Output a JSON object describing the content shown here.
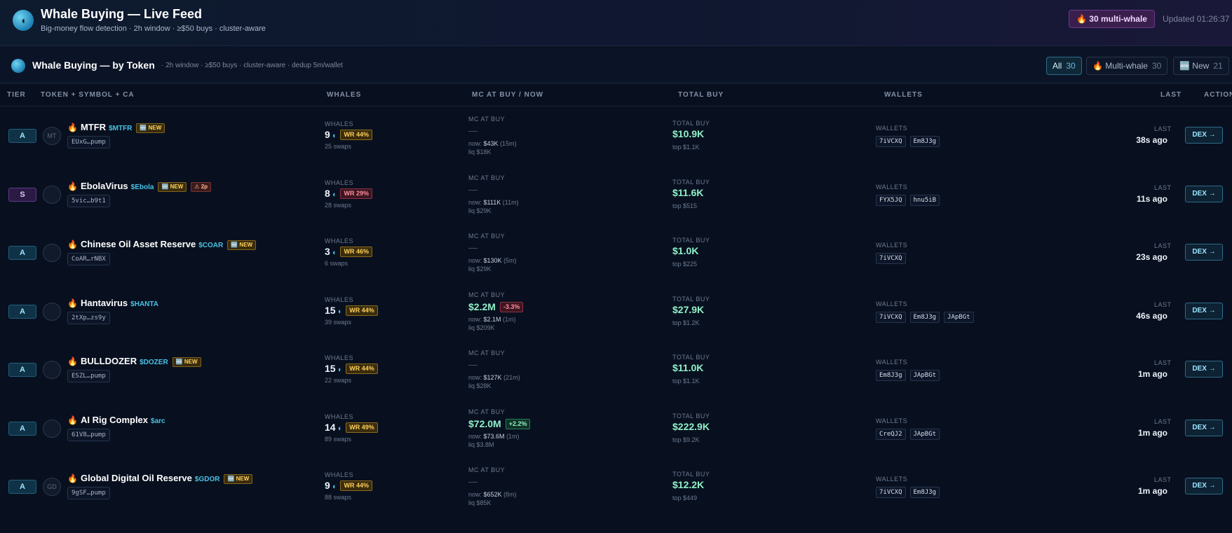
{
  "header": {
    "title": "Whale Buying — Live Feed",
    "subtitle": "Big-money flow detection · 2h window · ≥$50 buys · cluster-aware",
    "multiwhale_badge": "🔥 30 multi-whale",
    "updated": "Updated 01:26:37"
  },
  "section": {
    "title": "Whale Buying — by Token",
    "meta": "· 2h window · ≥$50 buys · cluster-aware · dedup 5m/wallet",
    "filters": [
      {
        "label": "All",
        "count": "30"
      },
      {
        "label": "🔥 Multi-whale",
        "count": "30"
      },
      {
        "label": "🆕 New",
        "count": "21"
      }
    ]
  },
  "columns": {
    "tier": "TIER",
    "token": "TOKEN + SYMBOL + CA",
    "whales": "WHALES",
    "mc": "MC AT BUY / NOW",
    "total": "TOTAL BUY",
    "wallets": "WALLETS",
    "last": "LAST",
    "action": "ACTION"
  },
  "labels": {
    "whales": "WHALES",
    "mc": "MC AT BUY",
    "total": "TOTAL BUY",
    "wallets": "WALLETS",
    "last": "LAST",
    "dash": "—",
    "dex": "DEX →",
    "new": "🆕 NEW"
  },
  "rows": [
    {
      "tier": "A",
      "avatar": "MT",
      "name": "MTFR",
      "symbol": "$MTFR",
      "new": true,
      "ca": "EUxG…pump",
      "whales": "9",
      "wr": "WR 44%",
      "swaps": "25 swaps",
      "mc_buy": "",
      "mc_delta": "",
      "now": "$43K",
      "now_age": "(15m)",
      "liq": "liq $18K",
      "total": "$10.9K",
      "top": "top $1.1K",
      "wallets": [
        "7iVCXQ",
        "Em8J3g"
      ],
      "last": "38s ago"
    },
    {
      "tier": "S",
      "avatar": "",
      "name": "EbolaVirus",
      "symbol": "$Ebola",
      "new": true,
      "warn": "⚠ 2p",
      "ca": "5vic…b9t1",
      "whales": "8",
      "wr": "WR 29%",
      "swaps": "28 swaps",
      "mc_buy": "",
      "mc_delta": "",
      "now": "$111K",
      "now_age": "(11m)",
      "liq": "liq $29K",
      "total": "$11.6K",
      "top": "top $515",
      "wallets": [
        "FYX5JQ",
        "hnu5iB"
      ],
      "last": "11s ago"
    },
    {
      "tier": "A",
      "avatar": "",
      "name": "Chinese Oil Asset Reserve",
      "symbol": "$COAR",
      "new": true,
      "ca": "CoAR…rNBX",
      "whales": "3",
      "wr": "WR 46%",
      "swaps": "6 swaps",
      "mc_buy": "",
      "mc_delta": "",
      "now": "$130K",
      "now_age": "(5m)",
      "liq": "liq $29K",
      "total": "$1.0K",
      "top": "top $225",
      "wallets": [
        "7iVCXQ"
      ],
      "last": "23s ago"
    },
    {
      "tier": "A",
      "avatar": "",
      "name": "Hantavirus",
      "symbol": "$HANTA",
      "new": false,
      "ca": "2tXp…zs9y",
      "whales": "15",
      "wr": "WR 44%",
      "swaps": "39 swaps",
      "mc_buy": "$2.2M",
      "mc_delta": "-3.3%",
      "now": "$2.1M",
      "now_age": "(1m)",
      "liq": "liq $209K",
      "total": "$27.9K",
      "top": "top $1.2K",
      "wallets": [
        "7iVCXQ",
        "Em8J3g",
        "JApBGt"
      ],
      "last": "46s ago"
    },
    {
      "tier": "A",
      "avatar": "",
      "name": "BULLDOZER",
      "symbol": "$DOZER",
      "new": true,
      "ca": "ESZL…pump",
      "whales": "15",
      "wr": "WR 44%",
      "swaps": "22 swaps",
      "mc_buy": "",
      "mc_delta": "",
      "now": "$127K",
      "now_age": "(21m)",
      "liq": "liq $28K",
      "total": "$11.0K",
      "top": "top $1.1K",
      "wallets": [
        "Em8J3g",
        "JApBGt"
      ],
      "last": "1m ago"
    },
    {
      "tier": "A",
      "avatar": "",
      "name": "AI Rig Complex",
      "symbol": "$arc",
      "new": false,
      "ca": "61V8…pump",
      "whales": "14",
      "wr": "WR 49%",
      "swaps": "89 swaps",
      "mc_buy": "$72.0M",
      "mc_delta": "+2.2%",
      "now": "$73.6M",
      "now_age": "(1m)",
      "liq": "liq $3.8M",
      "total": "$222.9K",
      "top": "top $9.2K",
      "wallets": [
        "CreQJ2",
        "JApBGt"
      ],
      "last": "1m ago"
    },
    {
      "tier": "A",
      "avatar": "GD",
      "name": "Global Digital Oil Reserve",
      "symbol": "$GDOR",
      "new": true,
      "ca": "9gSF…pump",
      "whales": "9",
      "wr": "WR 44%",
      "swaps": "88 swaps",
      "mc_buy": "",
      "mc_delta": "",
      "now": "$652K",
      "now_age": "(8m)",
      "liq": "liq $85K",
      "total": "$12.2K",
      "top": "top $449",
      "wallets": [
        "7iVCXQ",
        "Em8J3g"
      ],
      "last": "1m ago"
    }
  ],
  "colors": {
    "accent": "#49c2e4",
    "positive": "#8ff0c8",
    "negative": "#ff8c9f",
    "badge_gold": "#ffd15c"
  }
}
